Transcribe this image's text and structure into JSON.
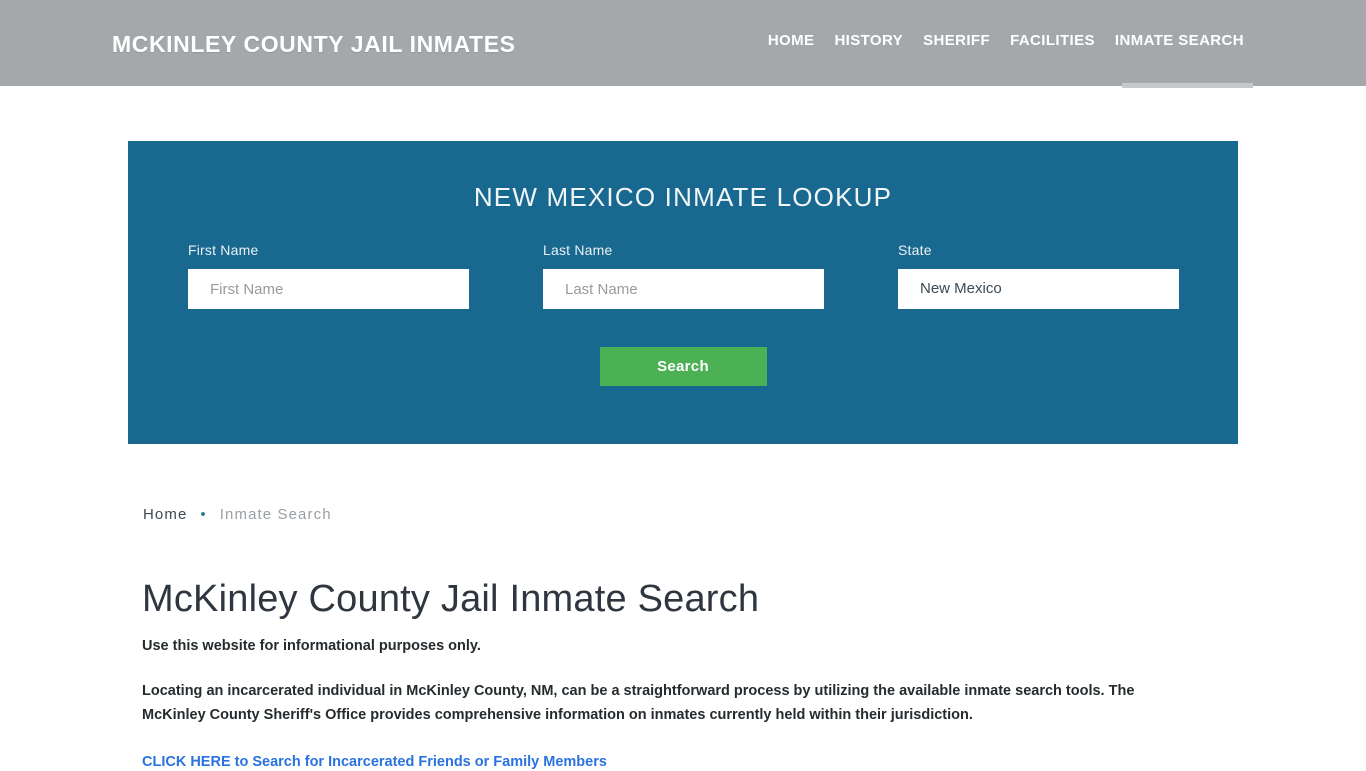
{
  "header": {
    "brand": "MCKINLEY COUNTY JAIL INMATES",
    "nav": [
      {
        "label": "HOME",
        "active": false
      },
      {
        "label": "HISTORY",
        "active": false
      },
      {
        "label": "SHERIFF",
        "active": false
      },
      {
        "label": "FACILITIES",
        "active": false
      },
      {
        "label": "INMATE SEARCH",
        "active": true
      }
    ],
    "bg_color": "#a4a8ab",
    "active_underline_color": "#c6c9cb"
  },
  "lookup": {
    "title": "NEW MEXICO INMATE LOOKUP",
    "panel_color": "#19688f",
    "fields": {
      "first_name": {
        "label": "First Name",
        "placeholder": "First Name",
        "value": ""
      },
      "last_name": {
        "label": "Last Name",
        "placeholder": "Last Name",
        "value": ""
      },
      "state": {
        "label": "State",
        "value": "New Mexico"
      }
    },
    "search_button": {
      "label": "Search",
      "color": "#4cb154"
    }
  },
  "breadcrumb": {
    "home": "Home",
    "separator": "•",
    "current": "Inmate Search"
  },
  "main": {
    "title": "McKinley County Jail Inmate Search",
    "paragraphs": [
      "Use this website for informational purposes only.",
      "Locating an incarcerated individual in McKinley County, NM, can be a straightforward process by utilizing the available inmate search tools. The McKinley County Sheriff's Office provides comprehensive information on inmates currently held within their jurisdiction."
    ],
    "link": {
      "text": "CLICK HERE to Search for Incarcerated Friends or Family Members",
      "color": "#2a72e0"
    }
  }
}
